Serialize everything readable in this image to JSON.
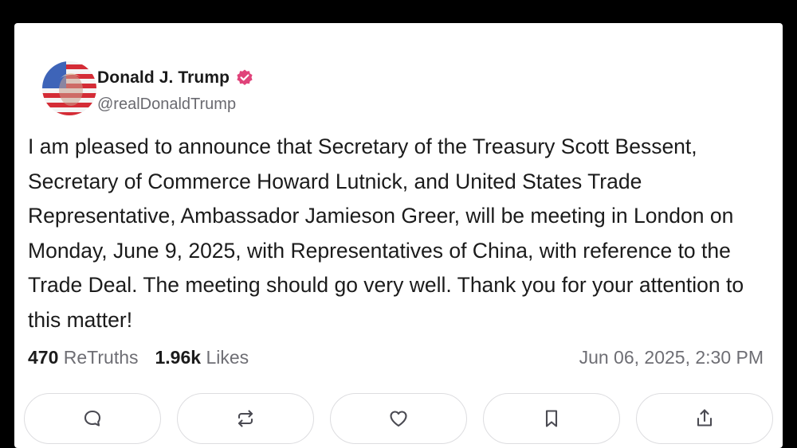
{
  "post": {
    "author_name": "Donald J. Trump",
    "handle": "@realDonaldTrump",
    "text": "I am pleased to announce that Secretary of the Treasury Scott Bessent, Secretary of Commerce Howard Lutnick, and United States Trade Representative, Ambassador Jamieson Greer, will be meeting in London on Monday, June 9, 2025, with Representatives of China, with reference to the Trade Deal. The meeting should go very well. Thank you for your attention to this matter!",
    "retruths_count": "470",
    "retruths_label": "ReTruths",
    "likes_count": "1.96k",
    "likes_label": "Likes",
    "timestamp": "Jun 06, 2025, 2:30 PM",
    "verified_color": "#e0437a"
  },
  "actions": [
    {
      "icon": "reply-icon"
    },
    {
      "icon": "retruth-icon"
    },
    {
      "icon": "like-icon"
    },
    {
      "icon": "bookmark-icon"
    },
    {
      "icon": "share-icon"
    }
  ]
}
